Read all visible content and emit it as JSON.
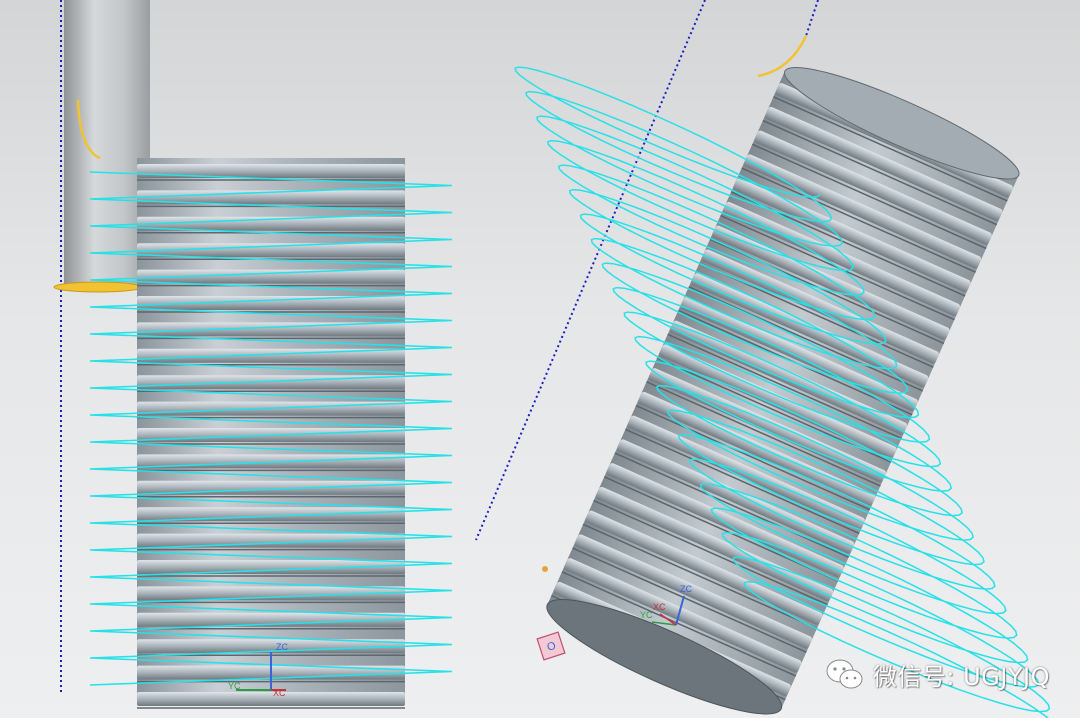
{
  "colors": {
    "toolpath": "#28e1e8",
    "boundary": "#1b1fc0",
    "tool_shank": "#b8bcbf",
    "tool_tip": "#f1c232",
    "thread_body": "#9ea7ae"
  },
  "icons": {
    "left_view_csys": "wcs-triad-icon",
    "right_view_csys": "wcs-triad-icon",
    "machine_origin": "mcs-origin-icon",
    "watermark_logo": "wechat-logo-icon"
  },
  "left_view": {
    "csys": {
      "zc": "ZC",
      "yc": "YC",
      "xc": "XC"
    }
  },
  "right_view": {
    "csys": {
      "zc": "ZC",
      "yc": "YC",
      "xc": "XC"
    },
    "origin_marker": "O"
  },
  "watermark": {
    "text": "微信号: UGJYJQ"
  }
}
